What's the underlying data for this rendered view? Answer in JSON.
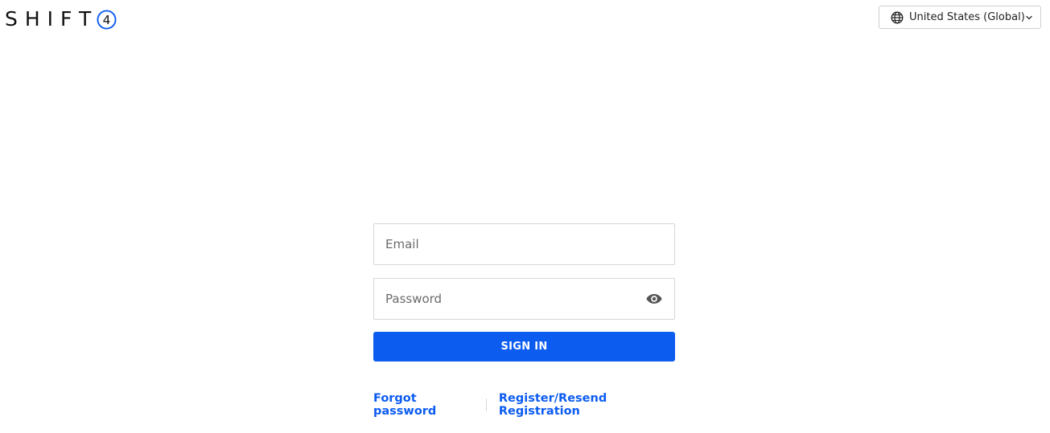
{
  "brand": {
    "logo_text": "SHIFT",
    "logo_mark_digit": "4",
    "accent_color": "#0c5cf0"
  },
  "header": {
    "region_selector": {
      "icon": "globe-icon",
      "selected": "United States (Global)",
      "chevron_icon": "chevron-down-icon"
    }
  },
  "login_form": {
    "email": {
      "placeholder": "Email",
      "value": ""
    },
    "password": {
      "placeholder": "Password",
      "value": "",
      "toggle_icon": "eye-icon"
    },
    "submit_label": "SIGN IN"
  },
  "links": {
    "forgot_password": "Forgot password",
    "register": "Register/Resend Registration"
  }
}
